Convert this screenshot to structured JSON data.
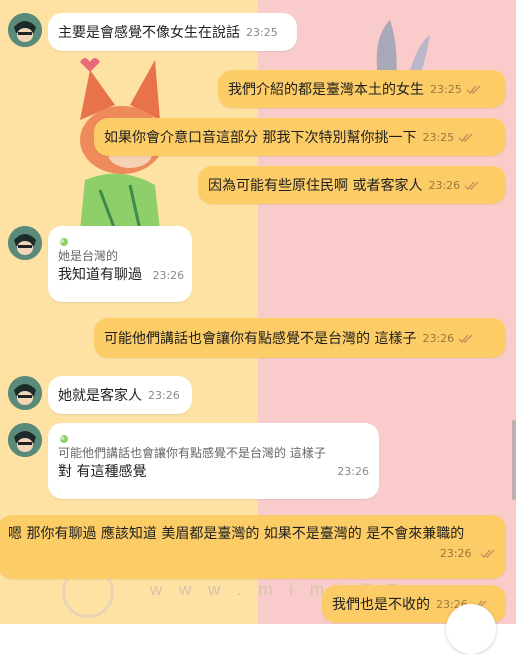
{
  "colors": {
    "left_bg": "#fde2a4",
    "right_bg": "#f9cbcb",
    "incoming_bubble": "#ffffff",
    "outgoing_bubble": "#fccc66",
    "check": "#c9925a"
  },
  "watermark": "w w w . m i m i 7 8",
  "messages": [
    {
      "text": "主要是會感覺不像女生在說話",
      "time": "23:25"
    },
    {
      "text": "我們介紹的都是臺灣本土的女生",
      "time": "23:25"
    },
    {
      "text": "如果你會介意口音這部分 那我下次特別幫你挑一下",
      "time": "23:25"
    },
    {
      "text": "因為可能有些原住民啊 或者客家人",
      "time": "23:26"
    },
    {
      "quote": "她是台灣的",
      "text": "我知道有聊過",
      "time": "23:26"
    },
    {
      "text": "可能他們講話也會讓你有點感覺不是台灣的 這樣子",
      "time": "23:26"
    },
    {
      "text": "她就是客家人",
      "time": "23:26"
    },
    {
      "quote": "可能他們講話也會讓你有點感覺不是台灣的 這樣子",
      "text": "對 有這種感覺",
      "time": "23:26"
    },
    {
      "text": "嗯 那你有聊過 應該知道 美眉都是臺灣的 如果不是臺灣的 是不會來兼職的",
      "time": "23:26"
    },
    {
      "text": "我們也是不收的",
      "time": "23:26"
    }
  ]
}
